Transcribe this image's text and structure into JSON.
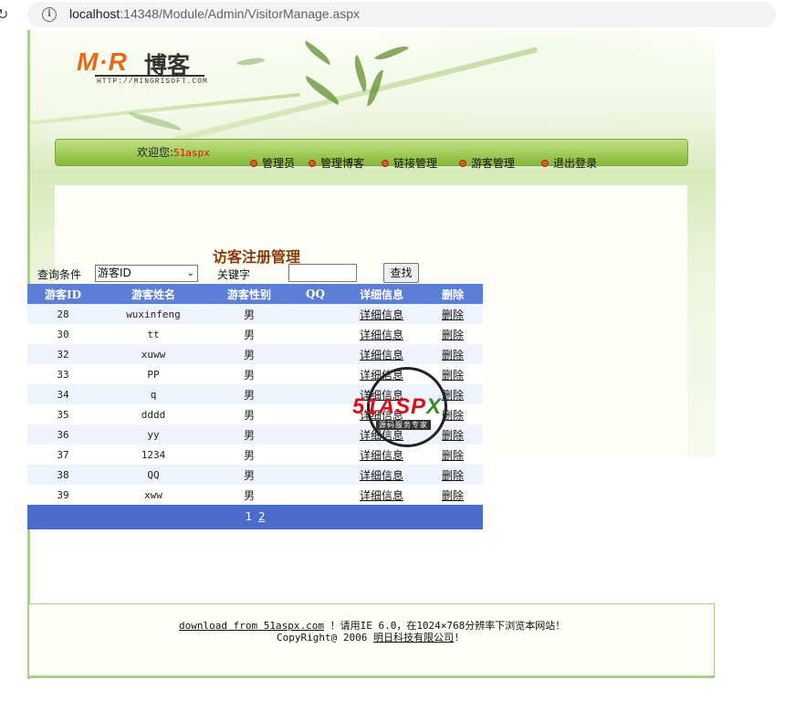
{
  "browser": {
    "url_host": "localhost",
    "url_rest": ":14348/Module/Admin/VisitorManage.aspx"
  },
  "logo": {
    "mr": "M·R",
    "cn": "博客",
    "sub": "HTTP://MINGRISOFT.COM"
  },
  "nav": {
    "welcome_label": "欢迎您:",
    "welcome_user": "51aspx",
    "items": [
      {
        "label": "管理员"
      },
      {
        "label": "管理博客"
      },
      {
        "label": "链接管理"
      },
      {
        "label": "游客管理"
      },
      {
        "label": "退出登录"
      }
    ]
  },
  "section_title": "访客注册管理",
  "search": {
    "condition_label": "查询条件",
    "condition_value": "游客ID",
    "keyword_label": "关键字",
    "keyword_value": "",
    "button_label": "查找"
  },
  "table": {
    "headers": [
      "游客ID",
      "游客姓名",
      "游客性别",
      "QQ",
      "详细信息",
      "删除"
    ],
    "rows": [
      {
        "id": "28",
        "name": "wuxinfeng",
        "gender": "男",
        "qq": "",
        "detail": "详细信息",
        "delete": "删除"
      },
      {
        "id": "30",
        "name": "tt",
        "gender": "男",
        "qq": "",
        "detail": "详细信息",
        "delete": "删除"
      },
      {
        "id": "32",
        "name": "xuww",
        "gender": "男",
        "qq": "",
        "detail": "详细信息",
        "delete": "删除"
      },
      {
        "id": "33",
        "name": "PP",
        "gender": "男",
        "qq": "",
        "detail": "详细信息",
        "delete": "删除"
      },
      {
        "id": "34",
        "name": "q",
        "gender": "男",
        "qq": "",
        "detail": "详细信息",
        "delete": "删除"
      },
      {
        "id": "35",
        "name": "dddd",
        "gender": "男",
        "qq": "",
        "detail": "详细信息",
        "delete": "删除"
      },
      {
        "id": "36",
        "name": "yy",
        "gender": "男",
        "qq": "",
        "detail": "详细信息",
        "delete": "删除"
      },
      {
        "id": "37",
        "name": "1234",
        "gender": "男",
        "qq": "",
        "detail": "详细信息",
        "delete": "删除"
      },
      {
        "id": "38",
        "name": "QQ",
        "gender": "男",
        "qq": "",
        "detail": "详细信息",
        "delete": "删除"
      },
      {
        "id": "39",
        "name": "xww",
        "gender": "男",
        "qq": "",
        "detail": "详细信息",
        "delete": "删除"
      }
    ],
    "pager": {
      "current": "1",
      "next": "2"
    }
  },
  "watermark": {
    "brand": "51ASP",
    "brand_x": "X",
    "slogan": "源码服务专家"
  },
  "footer": {
    "download_link": "download from 51aspx.com",
    "notice": "！请用IE 6.0，在1024×768分辨率下浏览本网站！",
    "copyright_prefix": "CopyRight@ 2006 ",
    "company_link": "明日科技有限公司",
    "copyright_suffix": "!"
  },
  "colors": {
    "header_blue": "#5b7fd6",
    "pager_blue": "#4a6dcb",
    "nav_green": "#9fcb55",
    "title_brown": "#8a3a08",
    "user_red": "#e4111a"
  }
}
